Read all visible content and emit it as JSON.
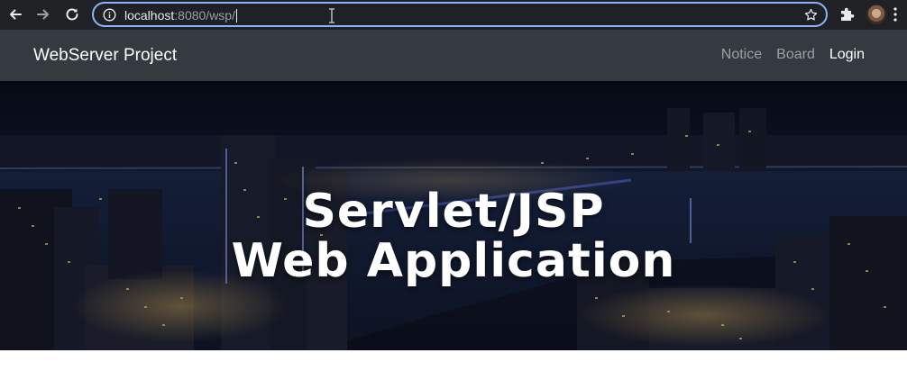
{
  "browser": {
    "url_host": "localhost",
    "url_rest": ":8080/wsp/",
    "icons": {
      "back": "arrow-left-icon",
      "forward": "arrow-right-icon",
      "reload": "reload-icon",
      "info": "info-icon",
      "bookmark": "star-icon",
      "extensions": "puzzle-icon",
      "profile": "avatar",
      "menu": "kebab-menu-icon"
    },
    "accent_color": "#8ab4f8"
  },
  "navbar": {
    "brand": "WebServer Project",
    "links": [
      {
        "label": "Notice",
        "active": false
      },
      {
        "label": "Board",
        "active": false
      },
      {
        "label": "Login",
        "active": true
      }
    ],
    "background": "#343a40"
  },
  "hero": {
    "title_line1": "Servlet/JSP",
    "title_line2": "Web Application"
  }
}
